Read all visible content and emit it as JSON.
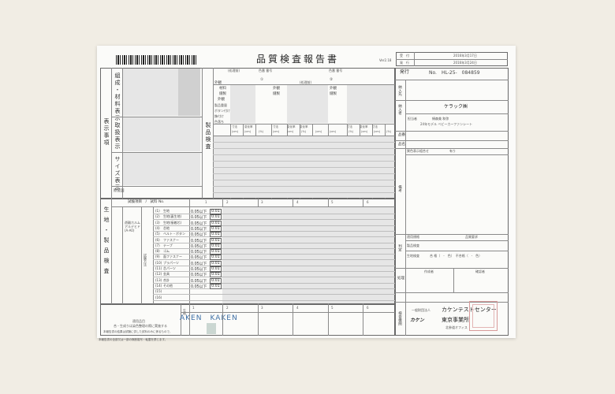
{
  "document": {
    "title": "品質検査報告書",
    "version": "Ver2.18",
    "header": {
      "labels": [
        "受　付",
        "発　行"
      ],
      "dates": [
        "2016年3月17日",
        "2016年3月24日"
      ],
      "issue_label": "発行",
      "issue_number": "No.　HL-25-　084859"
    },
    "left_section": {
      "label_vertical": "表示事項",
      "rows": [
        "組成・材料表示",
        "取扱表示",
        "サイズ表示"
      ],
      "origin_label": "原産国"
    },
    "middle_section": {
      "label_vertical": "製品検査",
      "sub_headers": [
        "(処理前)",
        "色番\n番号",
        "(処理前)",
        "色番\n番号"
      ],
      "circle_numbers": [
        "①",
        "②"
      ],
      "items": [
        "外観",
        "材料",
        "縫製",
        "外観",
        "製品重量",
        "ボタン付け",
        "飾付け",
        "色落ち"
      ],
      "col_headers": [
        "寸法",
        "変化率",
        "寸法",
        "変化率",
        "寸法",
        "変化率",
        "寸法",
        "変化率"
      ],
      "units": [
        "(cm)",
        "(cm)",
        "(%)",
        "(cm)",
        "(cm)",
        "(%)",
        "(cm)",
        "(cm)",
        "(%)",
        "(cm)",
        "(cm)",
        "(%)"
      ]
    },
    "right_section": {
      "applicant_label": "納入先",
      "recipient_label": "納入者",
      "company": "ケラック㈱",
      "person_label": "担当者",
      "person": "絹森美 和弥",
      "product_desc": "24年モデル ベビーカーファンシート",
      "item_labels": [
        "品番",
        "品名"
      ],
      "color_label": "異色表示組合せ",
      "color_value": "有り",
      "remarks_label": "備考",
      "judgment_label": "判定",
      "judgment_rows": [
        {
          "label": "適用規格",
          "value": "品質要求"
        },
        {
          "label": "製品検査",
          "value": ""
        },
        {
          "label": "生地検査",
          "value": "合 格（　-　色）　不合格（　-　色）"
        }
      ],
      "approval_labels": [
        "作成者",
        "確認者"
      ],
      "processing_label": "処理"
    },
    "test_section": {
      "label_vertical": "生地・製品検査",
      "header": "試験項目　/　試料 No.",
      "sample_numbers": [
        "1",
        "2",
        "3",
        "4",
        "5",
        "6"
      ],
      "method_label": "遊離ホルムアルデヒド(A-A0)",
      "standard_label": "試験方法",
      "items": [
        {
          "no": "(1)",
          "name": "生地",
          "value": "0.05以下",
          "limit": "0.01"
        },
        {
          "no": "(2)",
          "name": "生地(裏生地)",
          "value": "0.05以下",
          "limit": "0.01"
        },
        {
          "no": "(3)",
          "name": "生地(接着芯)",
          "value": "0.05以下",
          "limit": "0.01"
        },
        {
          "no": "(4)",
          "name": "芯地",
          "value": "0.05以下",
          "limit": "0.01"
        },
        {
          "no": "(5)",
          "name": "ベルト・ボタン",
          "value": "0.05以下",
          "limit": "0.01"
        },
        {
          "no": "(6)",
          "name": "ファスナー",
          "value": "0.05以下",
          "limit": "0.01"
        },
        {
          "no": "(7)",
          "name": "テープ",
          "value": "0.05以下",
          "limit": "0.01"
        },
        {
          "no": "(8)",
          "name": "ゴム",
          "value": "0.05以下",
          "limit": "0.01"
        },
        {
          "no": "(9)",
          "name": "面ファスナー",
          "value": "0.05以下",
          "limit": "0.01"
        },
        {
          "no": "(10)",
          "name": "プラパーツ",
          "value": "0.05以下",
          "limit": "0.01"
        },
        {
          "no": "(11)",
          "name": "芯パーツ",
          "value": "0.05以下",
          "limit": "0.01"
        },
        {
          "no": "(12)",
          "name": "金具",
          "value": "0.05以下",
          "limit": "0.01"
        },
        {
          "no": "(13)",
          "name": "合計",
          "value": "0.05以下",
          "limit": "0.01"
        },
        {
          "no": "(14)",
          "name": "その他",
          "value": "0.05以下",
          "limit": "0.01"
        },
        {
          "no": "(15)",
          "name": "",
          "value": "",
          "limit": ""
        },
        {
          "no": "(16)",
          "name": "",
          "value": "",
          "limit": ""
        }
      ]
    },
    "bottom": {
      "notes_title": "適用品目",
      "notes_body": "合・生成りは染色整理の際に実施する",
      "footnote": "本報告書の結果は試験に供した試料のみに係るもので、",
      "fabric_label": "生地",
      "stamp_text": "AKEN　KAKEN",
      "org_label": "検査機関",
      "org_prefix": "一般財団法人",
      "org_name": "カケンテストセンター",
      "org_logo": "カケン",
      "office": "東京事業所",
      "office_sub": "北参道オフィス",
      "footer": "本報告書の全部又は一部の無断複写・転載を禁じます。"
    }
  }
}
